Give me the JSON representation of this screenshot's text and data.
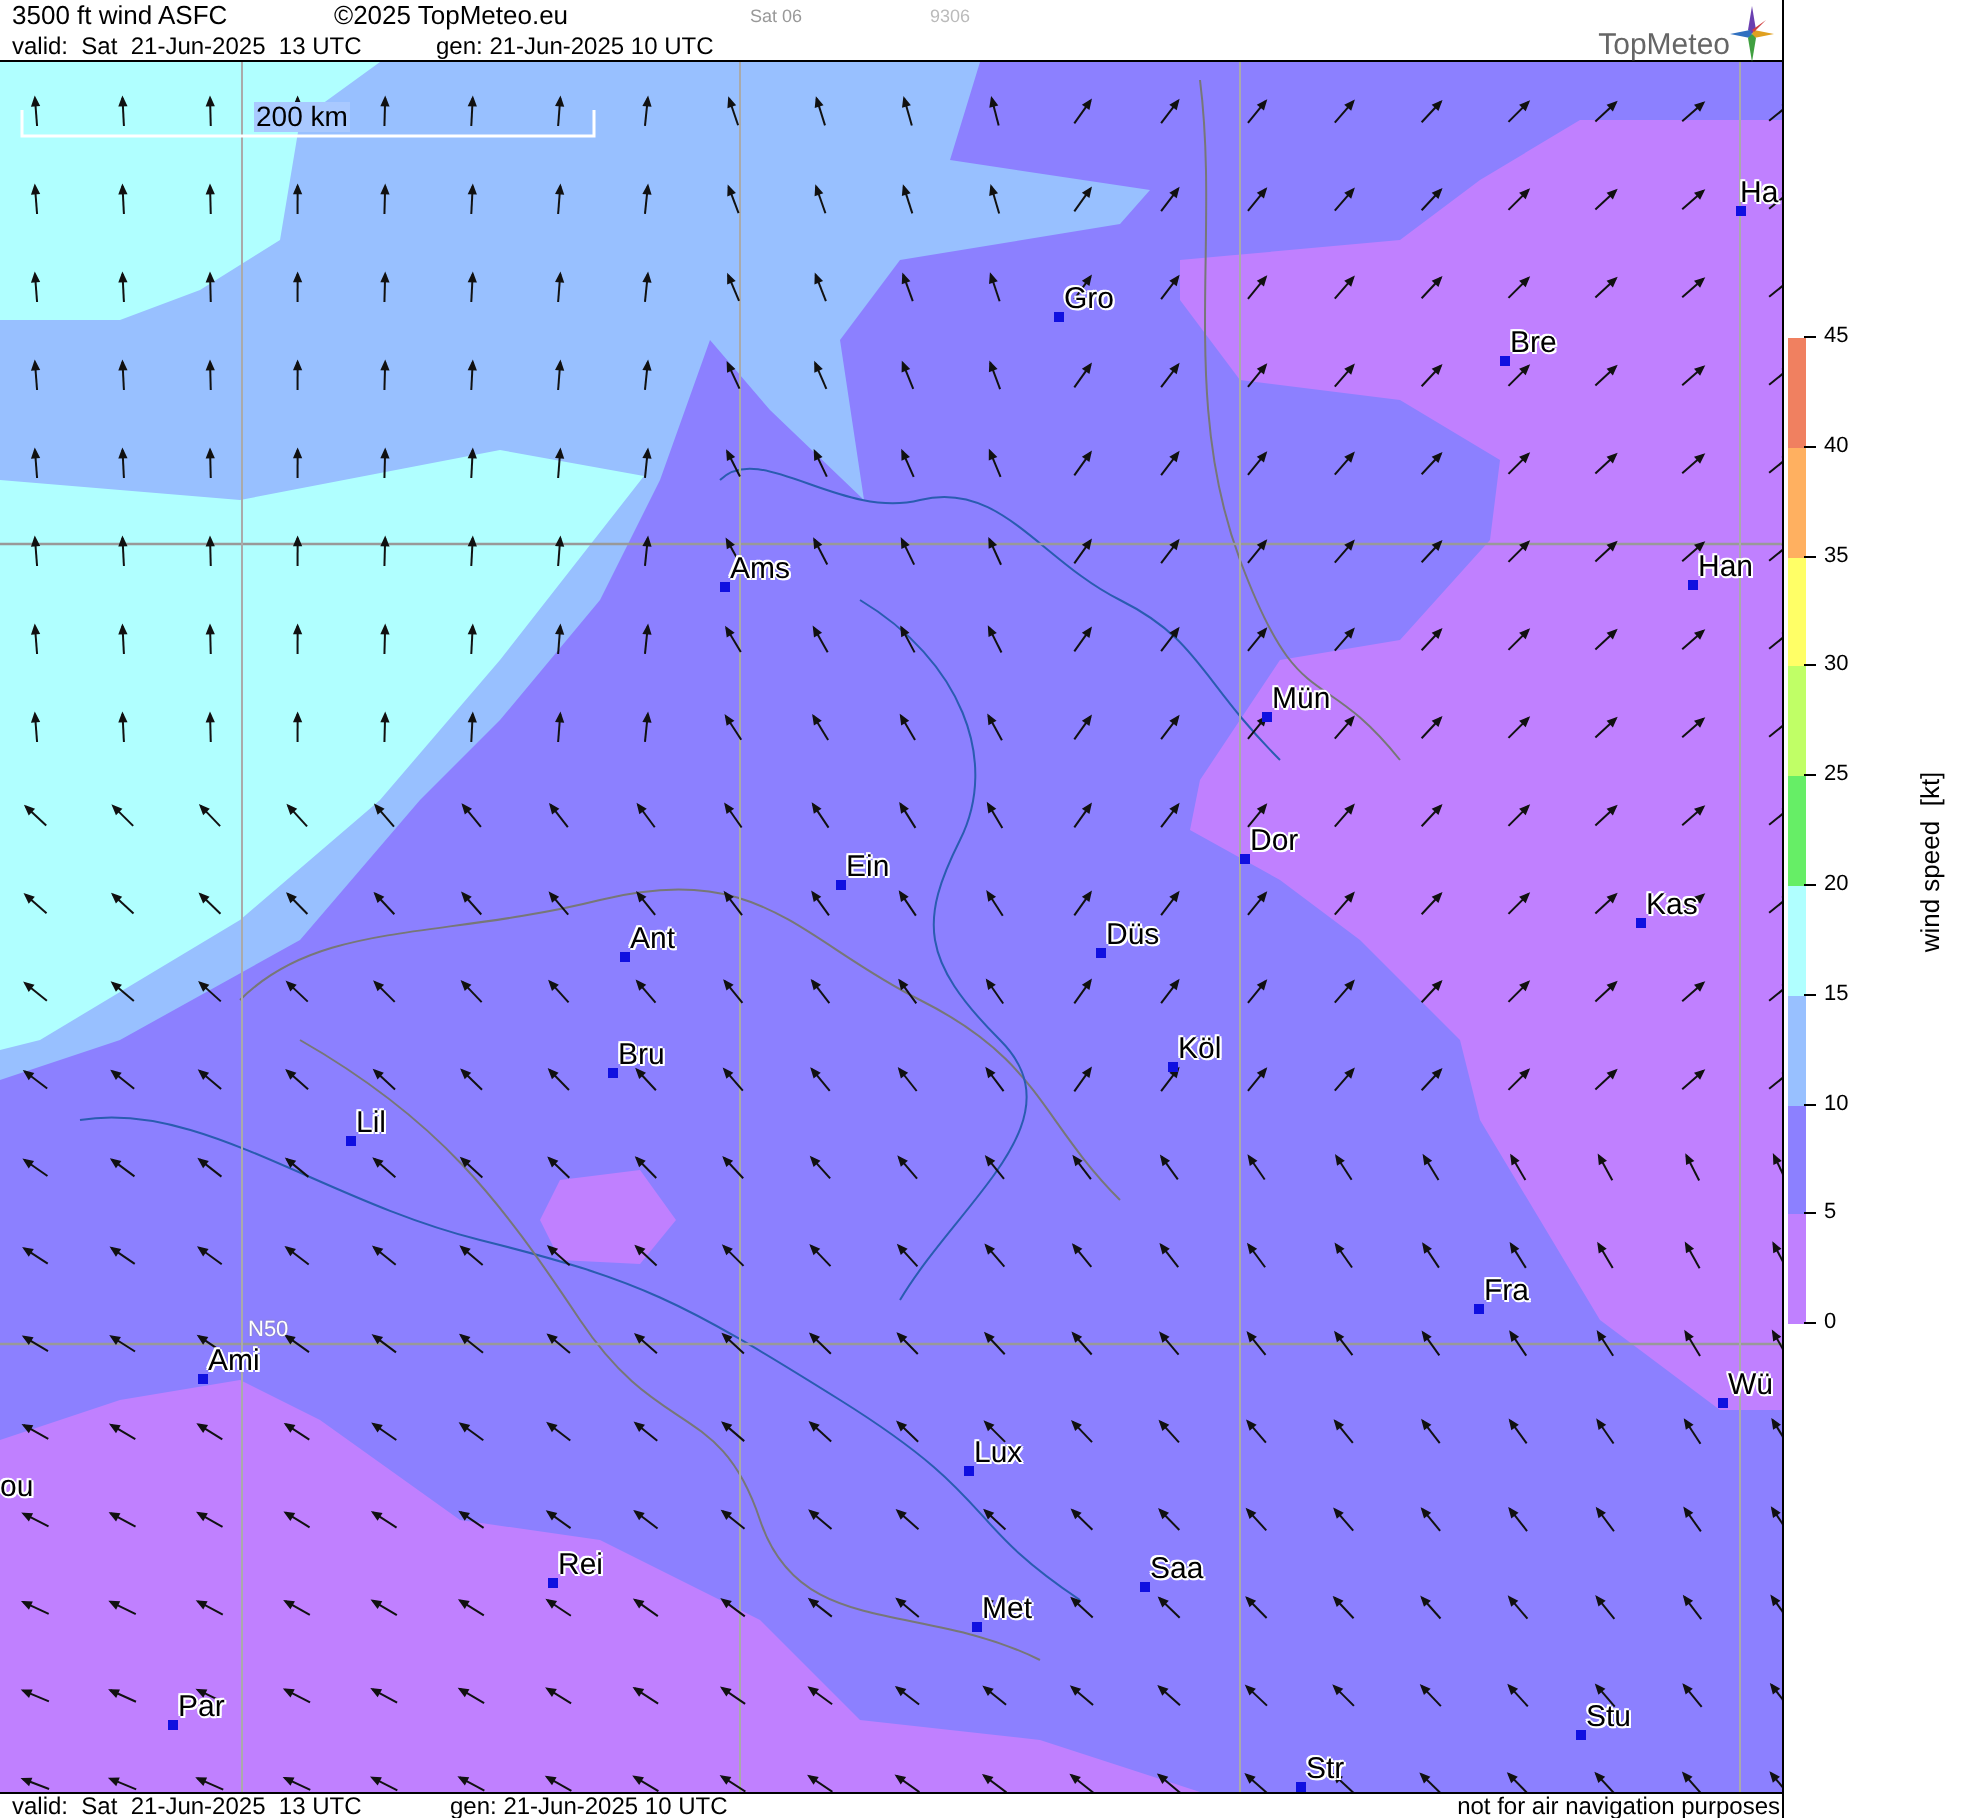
{
  "header": {
    "title": "3500 ft wind ASFC",
    "copyright": "©2025 TopMeteo.eu",
    "run_tag": "Sat 06",
    "code": "9306",
    "valid": "valid:  Sat  21-Jun-2025  13 UTC",
    "generated": "gen: 21-Jun-2025 10 UTC",
    "logo": "TopMeteo"
  },
  "map": {
    "scale_label": "200 km",
    "grid_label": "N50",
    "cities": [
      {
        "name": "Ha"
      },
      {
        "name": "Gro"
      },
      {
        "name": "Bre"
      },
      {
        "name": "Ams"
      },
      {
        "name": "Han"
      },
      {
        "name": "Mün"
      },
      {
        "name": "Dor"
      },
      {
        "name": "Ein"
      },
      {
        "name": "Kas"
      },
      {
        "name": "Ant"
      },
      {
        "name": "Düs"
      },
      {
        "name": "Köl"
      },
      {
        "name": "Bru"
      },
      {
        "name": "Lil"
      },
      {
        "name": "Fra"
      },
      {
        "name": "Ami"
      },
      {
        "name": "Wü"
      },
      {
        "name": "Lux"
      },
      {
        "name": "ou"
      },
      {
        "name": "Rei"
      },
      {
        "name": "Saa"
      },
      {
        "name": "Met"
      },
      {
        "name": "Par"
      },
      {
        "name": "Stu"
      },
      {
        "name": "Str"
      }
    ]
  },
  "legend": {
    "title": "wind speed  [kt]",
    "ticks": [
      "45",
      "40",
      "35",
      "30",
      "25",
      "20",
      "15",
      "10",
      "5",
      "0"
    ],
    "bands": [
      {
        "color": "#f08060"
      },
      {
        "color": "#ffb060"
      },
      {
        "color": "#ffff66"
      },
      {
        "color": "#c0ff66"
      },
      {
        "color": "#66ee66"
      },
      {
        "color": "#b0ffff"
      },
      {
        "color": "#98c0ff"
      },
      {
        "color": "#8c80ff"
      },
      {
        "color": "#c080ff"
      }
    ]
  },
  "footer": {
    "valid": "valid:  Sat  21-Jun-2025  13 UTC",
    "generated": "gen: 21-Jun-2025 10 UTC",
    "note": "not for air navigation purposes"
  }
}
